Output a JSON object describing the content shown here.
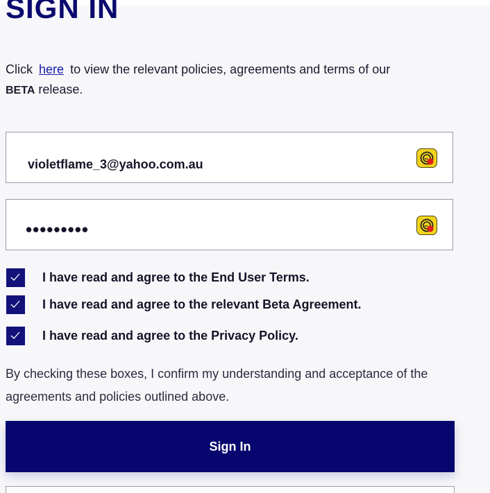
{
  "header": {
    "title": "SIGN IN"
  },
  "intro": {
    "prefix": "Click",
    "link_text": "here",
    "suffix": "to view the relevant policies, agreements and terms of our",
    "bold_word": "BETA",
    "tail": "release."
  },
  "form": {
    "email_value": "violetflame_3@yahoo.com.au",
    "password_masked": "•••••••••",
    "password_manager_icon": "password-manager-icon"
  },
  "agreements": [
    {
      "label": "I have read and agree to the End User Terms.",
      "checked": true
    },
    {
      "label": "I have read and agree to the relevant Beta Agreement.",
      "checked": true
    },
    {
      "label": "I have read and agree to the Privacy Policy.",
      "checked": true
    }
  ],
  "disclaimer": "By checking these boxes, I confirm my understanding and acceptance of the agreements and policies outlined above.",
  "actions": {
    "sign_in_label": "Sign In"
  },
  "colors": {
    "brand": "#06066e",
    "checkbox": "#12127a",
    "link": "#1a1aa8",
    "icon_yellow": "#f2d21c",
    "icon_red": "#e0201a"
  }
}
